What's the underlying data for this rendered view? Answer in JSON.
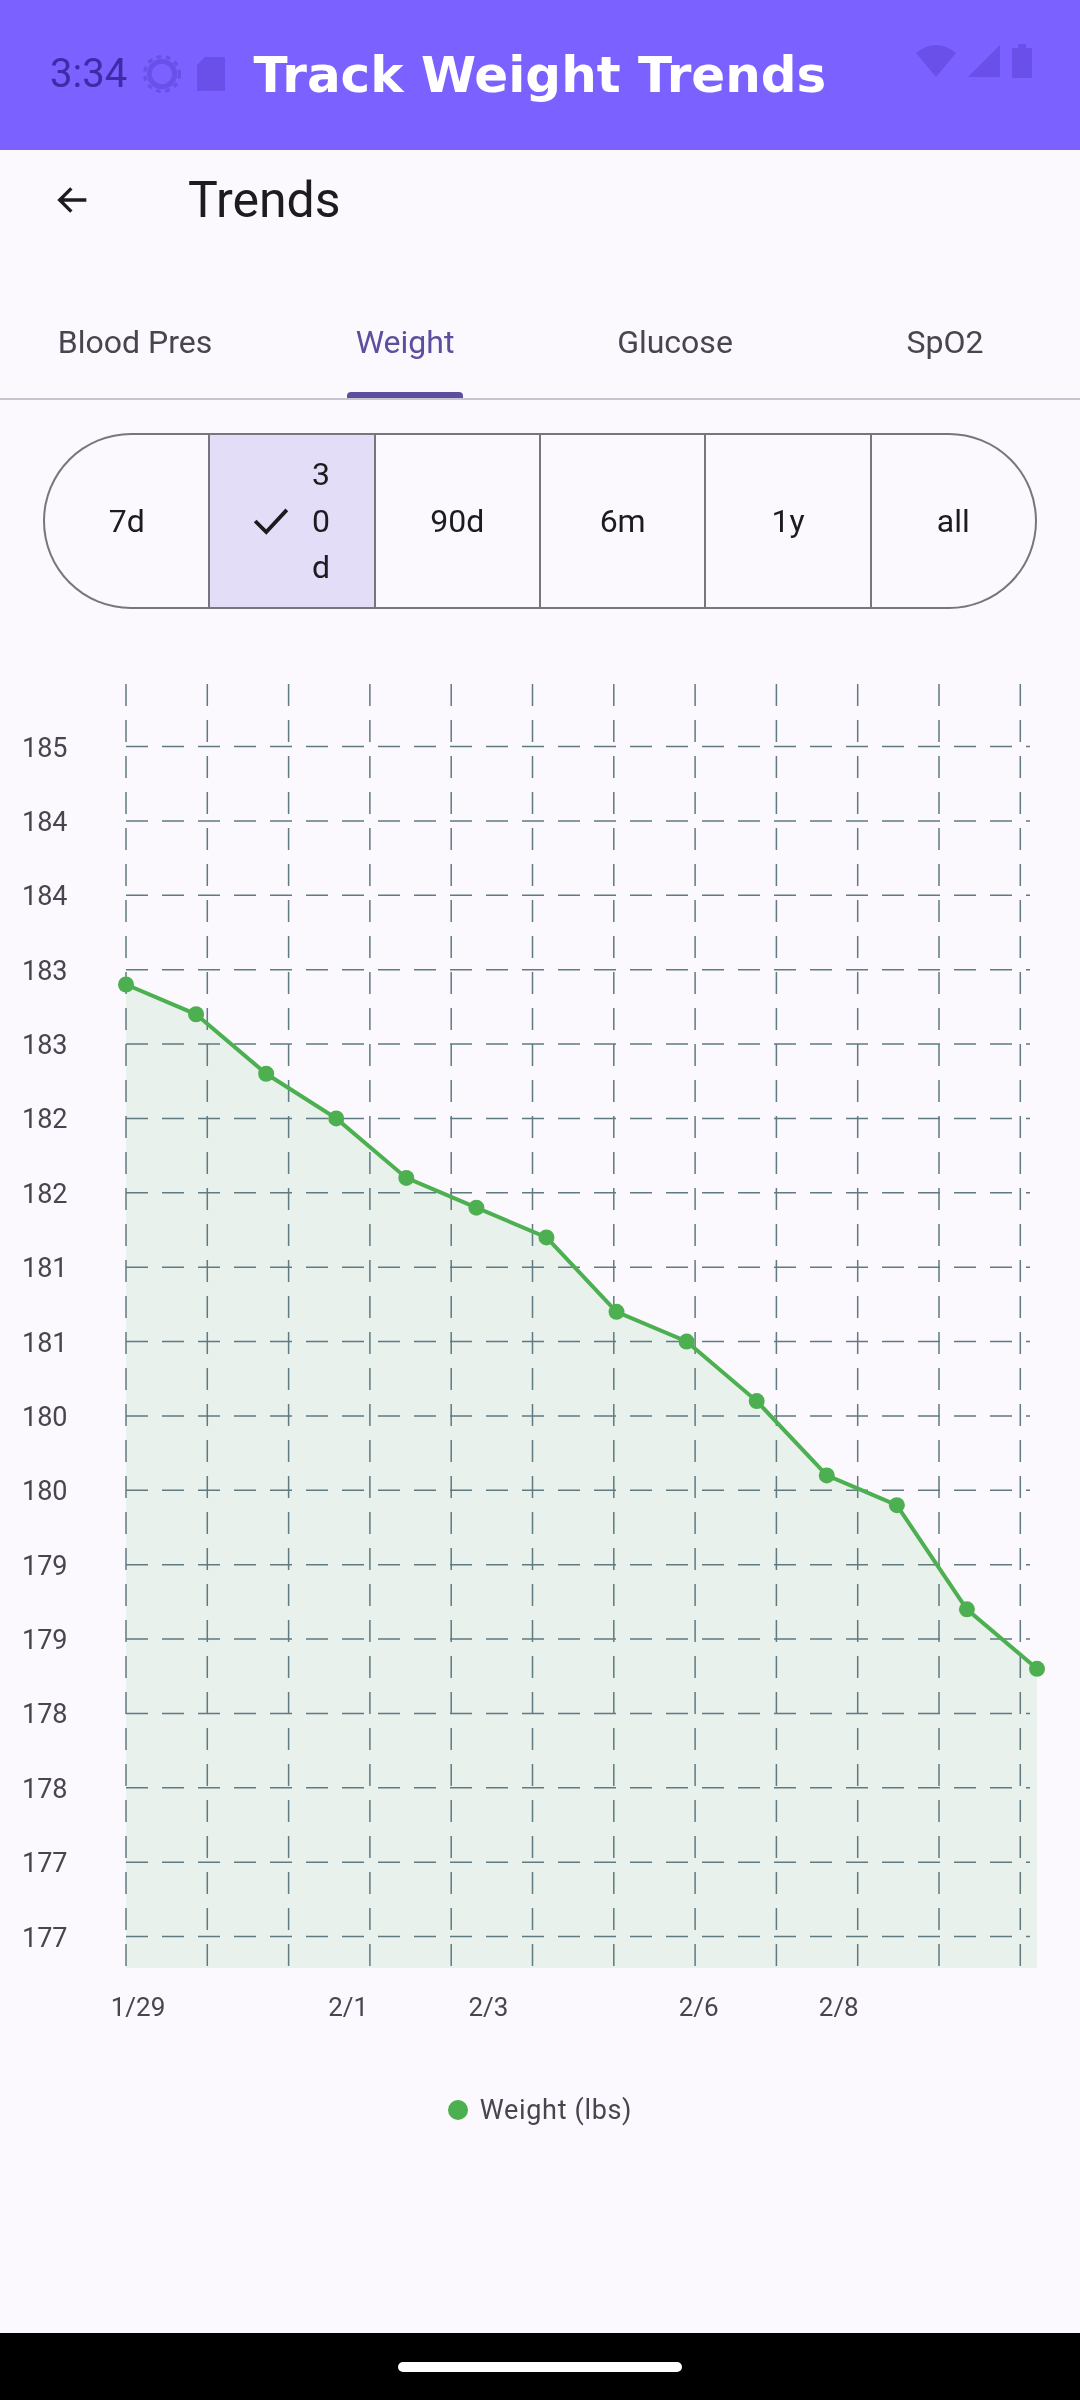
{
  "status_bar": {
    "time": "3:34"
  },
  "app_bar": {
    "title": "Track Weight Trends"
  },
  "toolbar": {
    "title": "Trends"
  },
  "tabs": [
    {
      "label": "Blood Pres",
      "selected": false
    },
    {
      "label": "Weight",
      "selected": true
    },
    {
      "label": "Glucose",
      "selected": false
    },
    {
      "label": "SpO2",
      "selected": false
    }
  ],
  "ranges": [
    {
      "label": "7d",
      "selected": false
    },
    {
      "label": "30d",
      "selected": true
    },
    {
      "label": "90d",
      "selected": false
    },
    {
      "label": "6m",
      "selected": false
    },
    {
      "label": "1y",
      "selected": false
    },
    {
      "label": "all",
      "selected": false
    }
  ],
  "chart": {
    "chart_data": {
      "type": "area",
      "grid": true,
      "categories": [
        "1/29",
        null,
        null,
        "2/1",
        null,
        "2/3",
        null,
        null,
        "2/6",
        null,
        "2/8",
        null,
        null,
        null
      ],
      "series": [
        {
          "name": "Weight (lbs)",
          "color": "#4caf50",
          "values": [
            183.4,
            183.2,
            182.8,
            182.5,
            182.1,
            181.9,
            181.7,
            181.2,
            181.0,
            180.6,
            180.1,
            179.9,
            179.2,
            178.8
          ]
        }
      ],
      "ylim": [
        177,
        185
      ],
      "yticks": [
        {
          "value": 185,
          "label": "185"
        },
        {
          "value": 184.5,
          "label": "184"
        },
        {
          "value": 184,
          "label": "184"
        },
        {
          "value": 183.5,
          "label": "183"
        },
        {
          "value": 183,
          "label": "183"
        },
        {
          "value": 182.5,
          "label": "182"
        },
        {
          "value": 182,
          "label": "182"
        },
        {
          "value": 181.5,
          "label": "181"
        },
        {
          "value": 181,
          "label": "181"
        },
        {
          "value": 180.5,
          "label": "180"
        },
        {
          "value": 180,
          "label": "180"
        },
        {
          "value": 179.5,
          "label": "179"
        },
        {
          "value": 179,
          "label": "179"
        },
        {
          "value": 178.5,
          "label": "178"
        },
        {
          "value": 178,
          "label": "178"
        },
        {
          "value": 177.5,
          "label": "177"
        },
        {
          "value": 177,
          "label": "177"
        }
      ]
    }
  }
}
